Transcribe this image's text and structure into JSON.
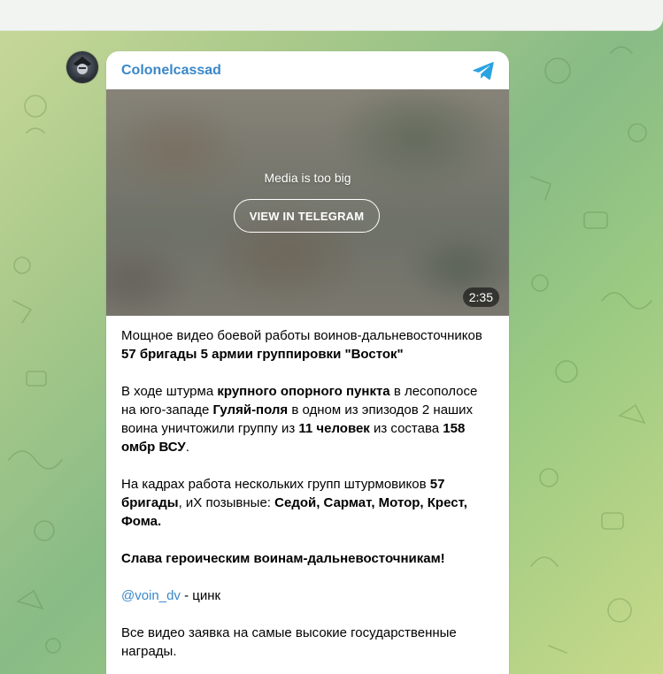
{
  "channel": {
    "name": "Colonelcassad",
    "avatar_icon": "channel-avatar-icon",
    "brand_icon": "telegram-plane-icon",
    "accent_color": "#3a87c9"
  },
  "media": {
    "message": "Media is too big",
    "button_label": "VIEW IN TELEGRAM",
    "duration": "2:35"
  },
  "post": {
    "p1": {
      "t1": "Мощное видео боевой работы воинов-дальневосточников ",
      "b1": "57 бригады 5 армии группировки \"Восток\""
    },
    "p2": {
      "t1": "В ходе штурма ",
      "b1": "крупного опорного пункта",
      "t2": " в лесополосе на юго-западе ",
      "b2": "Гуляй-поля",
      "t3": " в одном из эпизодов 2 наших воина уничтожили группу из ",
      "b3": "11 человек",
      "t4": " из состава ",
      "b4": "158 омбр ВСУ",
      "t5": "."
    },
    "p3": {
      "t1": "На кадрах работа нескольких групп штурмовиков ",
      "b1": "57 бригады",
      "t2": ", иХ позывные: ",
      "b2": "Седой, Сармат, Мотор, Крест, Фома."
    },
    "p4": {
      "b1": "Слава героическим воинам-дальневосточникам!"
    },
    "p5": {
      "link": "@voin_dv",
      "t1": " - цинк"
    },
    "p6": {
      "t1": "Все видео заявка на самые высокие государственные награды."
    }
  }
}
